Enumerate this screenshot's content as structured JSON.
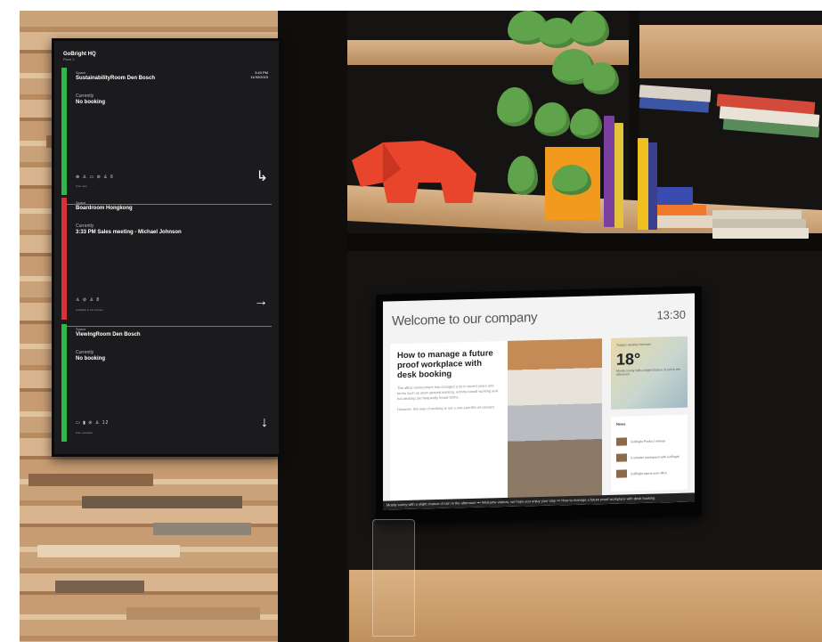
{
  "signage": {
    "brand": "GoBright HQ",
    "brand_sub": "Floor 1",
    "space_label": "Space",
    "currently_label": "Currently",
    "rooms": [
      {
        "name": "SustainabilityRoom Den Bosch",
        "time": "3:43 PM",
        "date": "11/30/2023",
        "currently": "No booking",
        "status_color": "#2eb84a",
        "amenities": "⊕ ♙ ▭ ⊘ ♙ 6",
        "availability": "Free now",
        "arrow": "↳"
      },
      {
        "name": "Boardroom Hongkong",
        "currently": "3:33 PM Sales meeting - Michael Johnson",
        "status_color": "#d9303a",
        "amenities": "♙ ⊘ ♙ 8",
        "availability": "Available in 23 minutes",
        "arrow": "→"
      },
      {
        "name": "ViewingRoom Den Bosch",
        "currently": "No booking",
        "status_color": "#2eb84a",
        "amenities": "▭ ▮ ⊘ ♙ 12",
        "availability": "Free until later",
        "arrow": "↓"
      }
    ]
  },
  "tv": {
    "title": "Welcome to our company",
    "clock": "13:30",
    "article": {
      "title": "How to manage a future proof workplace with desk booking",
      "p1": "The office environment has changed a lot in recent years and terms such as open spaced working, activity based working and hot desking are frequently heard terms.",
      "p2": "However, this way of working is not a one-size-fits-all concept."
    },
    "weather": {
      "label": "Today's weather forecast",
      "temp": "18°",
      "desc": "Mostly sunny with a slight chance of rain in the afternoon"
    },
    "news": {
      "title": "News",
      "items": [
        "GoBright Product release",
        "A smarter workspace with GoBright",
        "GoBright opens new office"
      ]
    },
    "ticker": "Mostly sunny with a slight chance of rain in the afternoon ••• Welcome visitors, we hope you enjoy your stay ••• How to manage a future proof workplace with desk booking"
  },
  "colors": {
    "available": "#2eb84a",
    "occupied": "#d9303a"
  }
}
